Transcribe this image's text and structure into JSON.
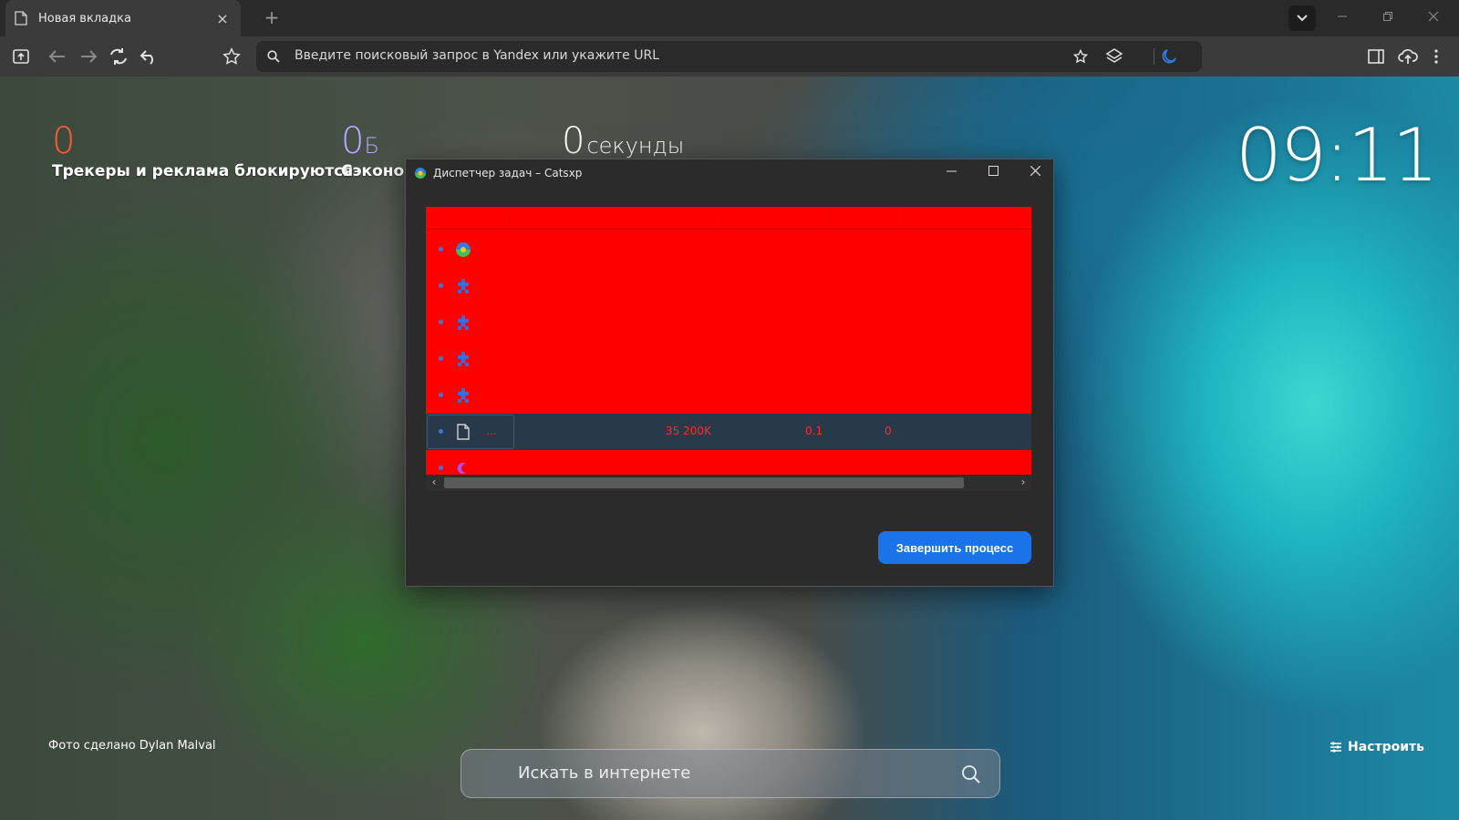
{
  "browser": {
    "tab_title": "Новая вкладка",
    "tab_close": "×",
    "new_tab": "+",
    "omnibox_placeholder": "Введите поисковый запрос в Yandex или укажите URL"
  },
  "newtab": {
    "stats": [
      {
        "value": "0",
        "unit": "",
        "label": "Трекеры и реклама блокируются",
        "color": "#ff5a36"
      },
      {
        "value": "0",
        "unit": "Б",
        "label": "Сэконом",
        "color": "#b8a8ff"
      },
      {
        "value": "0",
        "unit": "секунды",
        "label": "",
        "color": "#ffffff"
      }
    ],
    "clock": "09:11",
    "photo_credit": "Фото сделано Dylan Malval",
    "customize_label": "Настроить",
    "search_placeholder": "Искать в интернете"
  },
  "task_manager": {
    "title": "Диспетчер задач – Catsxp",
    "rows": [
      {
        "icon": "browser-logo-icon"
      },
      {
        "icon": "puzzle-icon"
      },
      {
        "icon": "puzzle-icon"
      },
      {
        "icon": "puzzle-icon"
      },
      {
        "icon": "puzzle-icon"
      },
      {
        "icon": "document-icon",
        "name": "...",
        "memory": "35 200K",
        "cpu": "0.1",
        "network": "0",
        "selected": true
      },
      {
        "icon": "moon-icon"
      }
    ],
    "scroll_left": "‹",
    "scroll_right": "›",
    "end_process_label": "Завершить процесс"
  },
  "colors": {
    "accent": "#1a73e8",
    "table_bg": "#ff0000",
    "selected_row": "#283a4a"
  }
}
